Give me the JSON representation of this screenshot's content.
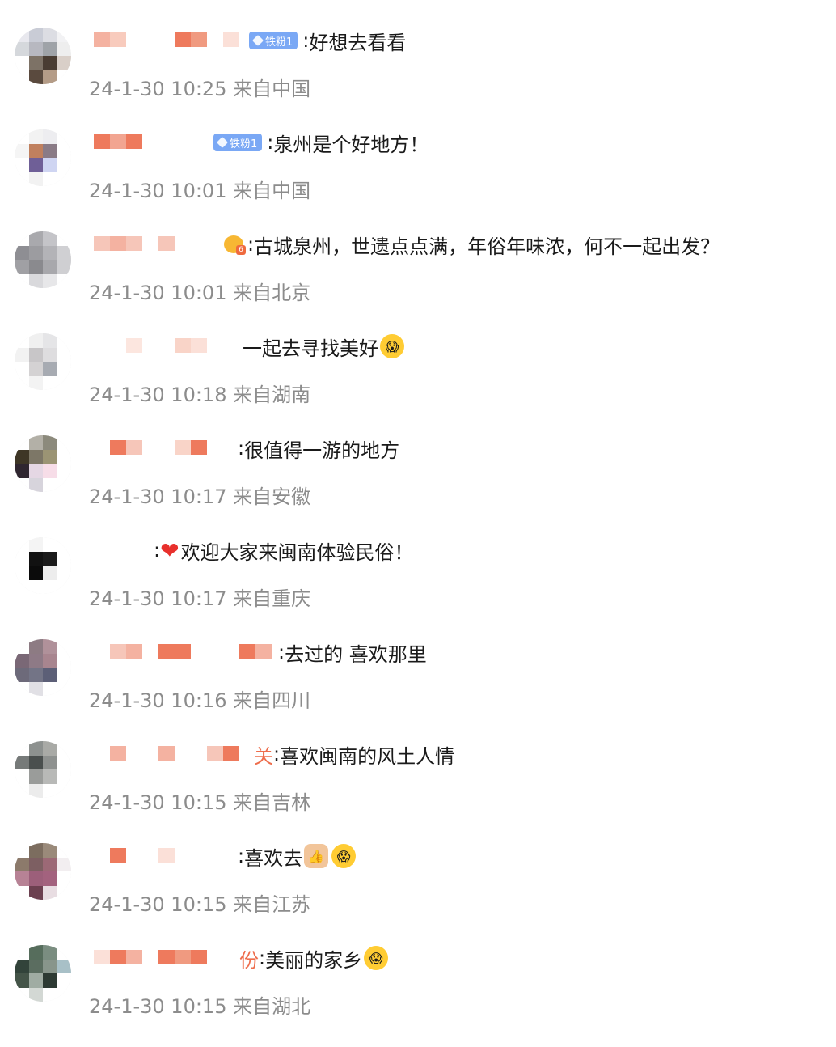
{
  "comments": [
    {
      "text": "好想去看看",
      "sep": ":",
      "time": "24-1-30 10:25",
      "from": "来自中国",
      "badge": "铁粉1"
    },
    {
      "text": "泉州是个好地方！",
      "sep": ":",
      "time": "24-1-30 10:01",
      "from": "来自中国",
      "badge": "铁粉1"
    },
    {
      "text": "古城泉州，世遗点点满，年俗年味浓，何不一起出发？",
      "sep": ":",
      "time": "24-1-30 10:01",
      "from": "来自北京",
      "badge_level": "6"
    },
    {
      "text": "一起去寻找美好",
      "sep": "",
      "time": "24-1-30 10:18",
      "from": "来自湖南",
      "emoji": "scream-face-icon"
    },
    {
      "text": "很值得一游的地方",
      "sep": ":",
      "time": "24-1-30 10:17",
      "from": "来自安徽"
    },
    {
      "text": "欢迎大家来闽南体验民俗！",
      "sep": ":",
      "time": "24-1-30 10:17",
      "from": "来自重庆",
      "emoji": "heart-icon"
    },
    {
      "text": "去过的 喜欢那里",
      "sep": ":",
      "time": "24-1-30 10:16",
      "from": "来自四川"
    },
    {
      "text": "喜欢闽南的风土人情",
      "sep": ":",
      "time": "24-1-30 10:15",
      "from": "来自吉林",
      "name_tail": "关"
    },
    {
      "text": "喜欢去",
      "sep": ":",
      "time": "24-1-30 10:15",
      "from": "来自江苏",
      "emoji": "thumbs-up-icon"
    },
    {
      "text": "美丽的家乡",
      "sep": ":",
      "time": "24-1-30 10:15",
      "from": "来自湖北",
      "name_tail": "份",
      "emoji": "scream-face-icon"
    }
  ],
  "colors": {
    "text": "#1a1a1a",
    "timestamp": "#8c8c8c",
    "fan_badge": "#7aa8f5",
    "mosaic_accent": "#ee6d4c"
  }
}
